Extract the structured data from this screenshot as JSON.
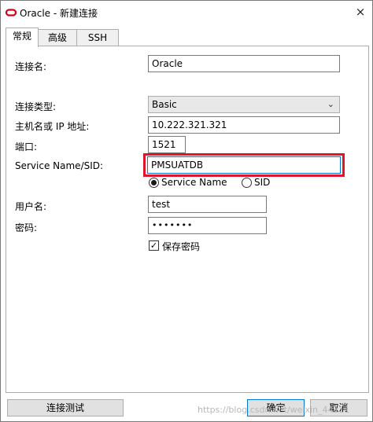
{
  "window": {
    "title": "Oracle - 新建连接",
    "close_glyph": "×"
  },
  "tabs": [
    {
      "label": "常规"
    },
    {
      "label": "高级"
    },
    {
      "label": "SSH"
    }
  ],
  "form": {
    "conn_name_label": "连接名:",
    "conn_name_value": "Oracle",
    "conn_type_label": "连接类型:",
    "conn_type_value": "Basic",
    "host_label": "主机名或 IP 地址:",
    "host_value": "10.222.321.321",
    "port_label": "端口:",
    "port_value": "1521",
    "service_label": "Service Name/SID:",
    "service_value": "PMSUATDB",
    "radio_service_name": "Service Name",
    "radio_sid": "SID",
    "user_label": "用户名:",
    "user_value": "test",
    "password_label": "密码:",
    "password_value": "•••••••",
    "save_password_label": "保存密码"
  },
  "buttons": {
    "test": "连接测试",
    "ok": "确定",
    "cancel": "取消"
  },
  "watermark": "https://blog.csdn.net/weixin_44111"
}
